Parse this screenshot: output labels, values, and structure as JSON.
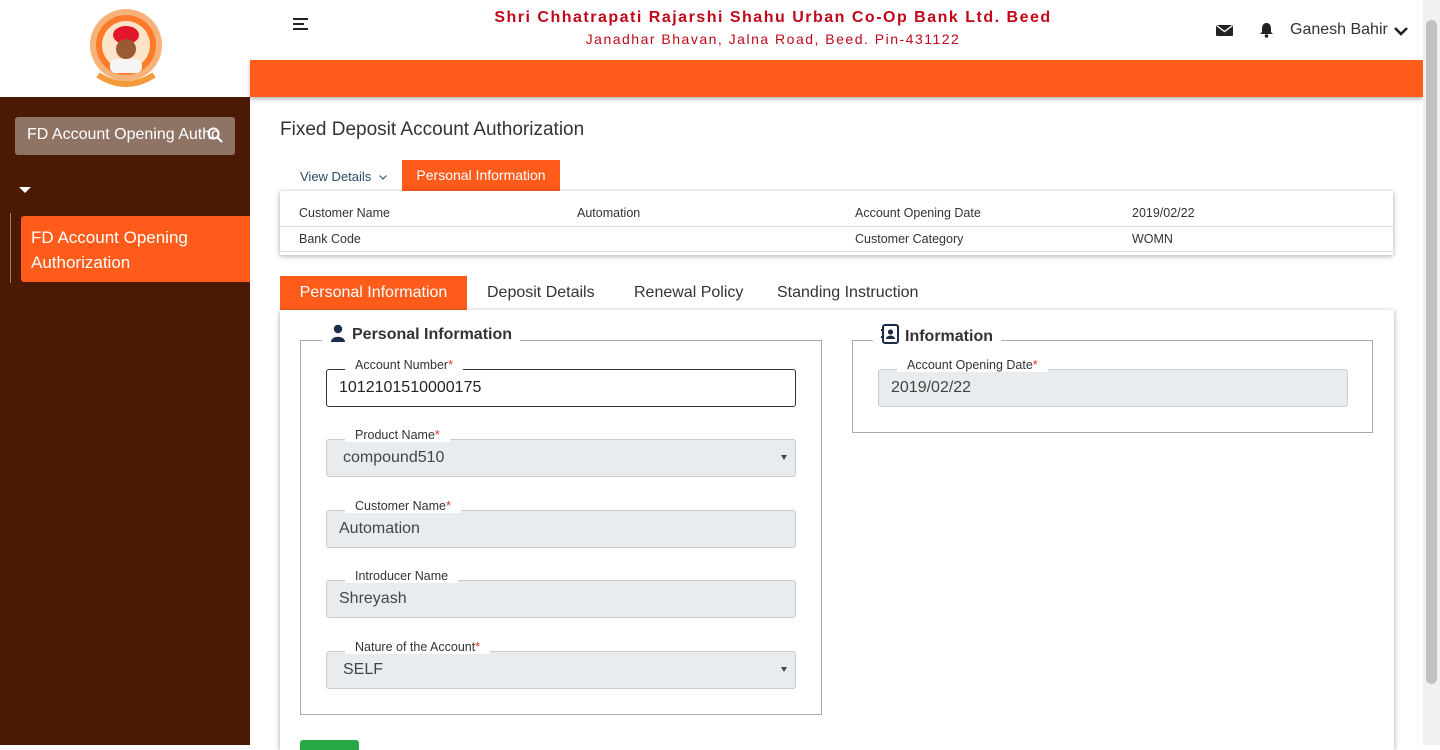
{
  "header": {
    "bank_name": "Shri Chhatrapati Rajarshi Shahu Urban Co-Op Bank Ltd. Beed",
    "bank_address": "Janadhar Bhavan, Jalna Road, Beed. Pin-431122",
    "user_name": "Ganesh Bahir"
  },
  "sidebar": {
    "search_value": "FD Account Opening Autho",
    "active_item": "FD Account Opening Authorization"
  },
  "page": {
    "title": "Fixed Deposit Account Authorization",
    "top_tabs": {
      "view_details": "View Details",
      "personal_information": "Personal Information"
    }
  },
  "summary": {
    "row1": {
      "label1": "Customer Name",
      "value1": "Automation",
      "label2": "Account Opening Date",
      "value2": "2019/02/22"
    },
    "row2": {
      "label1": "Bank Code",
      "value1": "",
      "label2": "Customer Category",
      "value2": "WOMN"
    }
  },
  "tabs": [
    "Personal Information",
    "Deposit Details",
    "Renewal Policy",
    "Standing Instruction"
  ],
  "personal": {
    "legend": "Personal Information",
    "account_number": {
      "label": "Account Number",
      "value": "1012101510000175"
    },
    "product_name": {
      "label": "Product Name",
      "value": "compound510"
    },
    "customer_name": {
      "label": "Customer Name",
      "value": "Automation"
    },
    "introducer_name": {
      "label": "Introducer Name",
      "value": "Shreyash"
    },
    "nature": {
      "label": "Nature of the Account",
      "value": "SELF"
    }
  },
  "information": {
    "legend": "Information",
    "opening_date": {
      "label": "Account Opening Date",
      "value": "2019/02/22"
    }
  },
  "colors": {
    "primary": "#ff5c1c",
    "sidebar": "#4a1a05",
    "bank_red": "#c0081a"
  }
}
